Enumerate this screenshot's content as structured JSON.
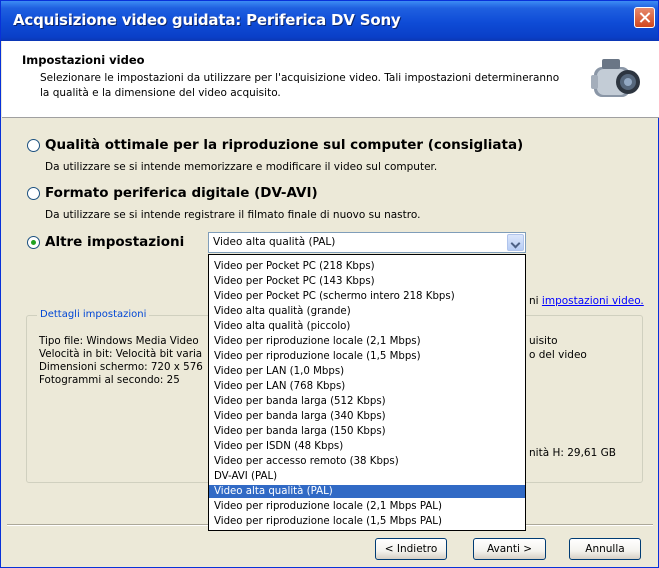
{
  "window": {
    "title": "Acquisizione video guidata: Periferica DV Sony"
  },
  "header": {
    "title": "Impostazioni video",
    "description": "Selezionare le impostazioni da utilizzare per l'acquisizione video. Tali impostazioni determineranno la qualità e la dimensione del video acquisito."
  },
  "options": [
    {
      "label": "Qualità ottimale per la riproduzione sul computer (consigliata)",
      "description": "Da utilizzare se si intende memorizzare e modificare il video sul computer.",
      "checked": false
    },
    {
      "label": "Formato periferica digitale (DV-AVI)",
      "description": "Da utilizzare se si intende registrare il filmato finale di nuovo su nastro.",
      "checked": false
    },
    {
      "label": "Altre impostazioni",
      "checked": true
    }
  ],
  "combo": {
    "selected": "Video alta qualità (PAL)"
  },
  "dropdown": {
    "items": [
      "Video per Pocket PC (218 Kbps)",
      "Video per Pocket PC (143 Kbps)",
      "Video per Pocket PC (schermo intero 218 Kbps)",
      "Video alta qualità (grande)",
      "Video alta qualità (piccolo)",
      "Video per riproduzione locale (2,1 Mbps)",
      "Video per riproduzione locale (1,5 Mbps)",
      "Video per LAN (1,0 Mbps)",
      "Video per LAN (768 Kbps)",
      "Video per banda larga (512 Kbps)",
      "Video per banda larga (340 Kbps)",
      "Video per banda larga (150 Kbps)",
      "Video per ISDN (48 Kbps)",
      "Video per accesso remoto (38 Kbps)",
      "DV-AVI (PAL)",
      "Video alta qualità (PAL)",
      "Video per riproduzione locale (2,1 Mbps PAL)",
      "Video per riproduzione locale (1,5 Mbps PAL)"
    ],
    "selected_index": 15
  },
  "details": {
    "group_title": "Dettagli impostazioni",
    "lines": [
      "Tipo file: Windows Media Video",
      "Velocità in bit: Velocità bit varia",
      "Dimensioni schermo: 720 x 576",
      "Fotogrammi al secondo: 25"
    ],
    "link_prefix": "ni",
    "link_text": "impostazioni video.",
    "right_line1": "uisito",
    "right_line2": "o del video",
    "disk_space": "nità H: 29,61 GB"
  },
  "buttons": {
    "back": "< Indietro",
    "next": "Avanti >",
    "cancel": "Annulla"
  }
}
